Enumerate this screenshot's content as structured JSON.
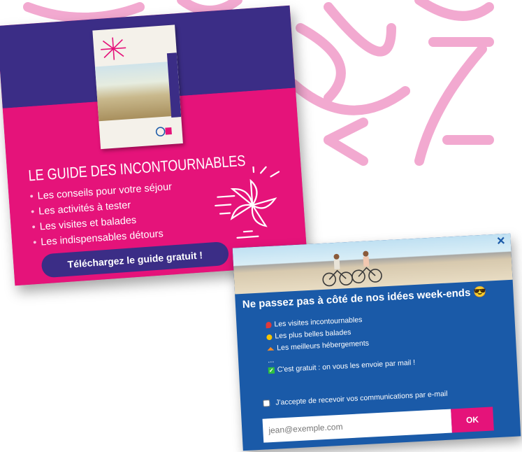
{
  "colors": {
    "pink": "#e5137a",
    "purple": "#3b2d86",
    "blue": "#1a5aa8",
    "deco": "#f2a9d0"
  },
  "guide_card": {
    "heading": "LE GUIDE DES INCONTOURNABLES",
    "items": [
      "Les conseils pour votre séjour",
      "Les activités à tester",
      "Les visites et balades",
      "Les indispensables détours"
    ],
    "cta_label": "Téléchargez le guide gratuit !"
  },
  "newsletter_card": {
    "close_label": "×",
    "title": "Ne passez pas à côté de nos idées week-ends 😎",
    "items": [
      {
        "icon": "pin-icon",
        "text": "Les visites incontournables"
      },
      {
        "icon": "sun-icon",
        "text": "Les plus belles balades"
      },
      {
        "icon": "house-icon",
        "text": "Les meilleurs hébergements"
      }
    ],
    "ellipsis": "...",
    "free_note": "C'est gratuit : on vous les envoie par mail !",
    "consent_label": "J'accepte de recevoir vos communications par e-mail",
    "email_placeholder": "jean@exemple.com",
    "ok_label": "OK"
  }
}
